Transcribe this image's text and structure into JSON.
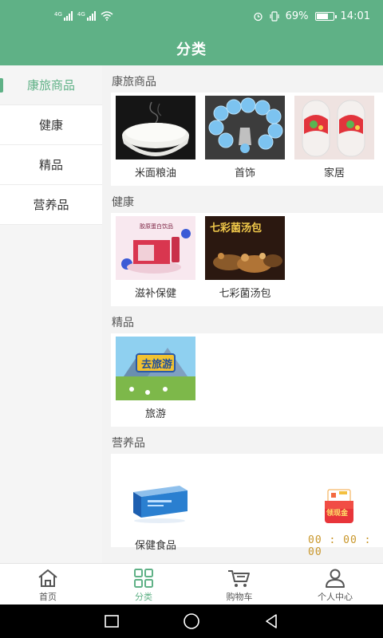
{
  "status": {
    "signal1_label": "4G",
    "signal2_label": "4G",
    "battery": "69%",
    "time": "14:01"
  },
  "header": {
    "title": "分类"
  },
  "sidebar": {
    "items": [
      {
        "label": "康旅商品",
        "active": true
      },
      {
        "label": "健康"
      },
      {
        "label": "精品"
      },
      {
        "label": "营养品"
      }
    ]
  },
  "sections": [
    {
      "title": "康旅商品",
      "products": [
        {
          "name": "米面粮油",
          "image": "rice-bowl"
        },
        {
          "name": "首饰",
          "image": "bracelet"
        },
        {
          "name": "家居",
          "image": "slippers"
        }
      ]
    },
    {
      "title": "健康",
      "products": [
        {
          "name": "滋补保健",
          "image": "collagen-drink",
          "img_text": "胶原蛋白饮品"
        },
        {
          "name": "七彩菌汤包",
          "image": "mushroom-soup",
          "img_text": "七彩菌汤包"
        }
      ]
    },
    {
      "title": "精品",
      "products": [
        {
          "name": "旅游",
          "image": "travel-poster",
          "img_text": "去旅游"
        }
      ]
    },
    {
      "title": "营养品",
      "products": [
        {
          "name": "保健食品",
          "image": "health-box"
        }
      ]
    }
  ],
  "coupon": {
    "label": "领现金",
    "timer": "00 : 00 : 00"
  },
  "tabbar": {
    "items": [
      {
        "label": "首页",
        "icon": "home-icon"
      },
      {
        "label": "分类",
        "icon": "grid-icon",
        "active": true
      },
      {
        "label": "购物车",
        "icon": "cart-icon"
      },
      {
        "label": "个人中心",
        "icon": "person-icon"
      }
    ]
  },
  "colors": {
    "brand": "#5fb186",
    "timer": "#c9972b"
  }
}
